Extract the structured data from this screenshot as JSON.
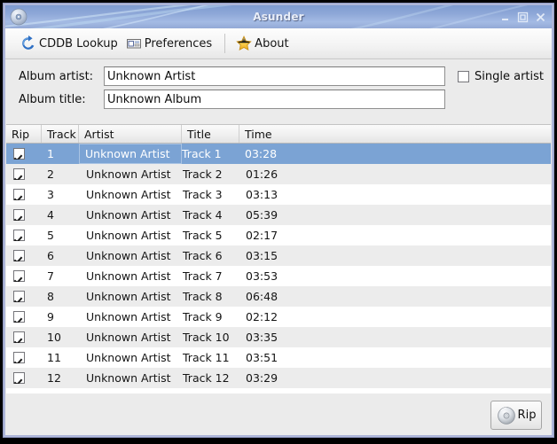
{
  "window": {
    "title": "Asunder",
    "icon": "cd-disc-icon",
    "controls": {
      "minimize": "–",
      "maximize": "❒",
      "close": "✕"
    },
    "border_color": "#b3bbdd",
    "titlebar_color": "#8fa8d8"
  },
  "toolbar": {
    "items": [
      {
        "label": "CDDB Lookup",
        "icon": "refresh-circle-icon"
      },
      {
        "label": "Preferences",
        "icon": "window-panel-icon"
      },
      {
        "label": "About",
        "icon": "star-icon"
      }
    ]
  },
  "form": {
    "album_artist": {
      "label": "Album artist:",
      "value": "Unknown Artist",
      "placeholder": ""
    },
    "album_title": {
      "label": "Album title:",
      "value": "Unknown Album",
      "placeholder": ""
    },
    "single_artist": {
      "label": "Single artist",
      "checked": false
    }
  },
  "track_list": {
    "columns": [
      "Rip",
      "Track",
      "Artist",
      "Title",
      "Time"
    ],
    "selected_index": 0,
    "selection_color": "#7ba3d4",
    "alt_row_color": "#ececec",
    "rows": [
      {
        "rip": true,
        "track": "1",
        "artist": "Unknown Artist",
        "title": "Track 1",
        "time": "03:28"
      },
      {
        "rip": true,
        "track": "2",
        "artist": "Unknown Artist",
        "title": "Track 2",
        "time": "01:26"
      },
      {
        "rip": true,
        "track": "3",
        "artist": "Unknown Artist",
        "title": "Track 3",
        "time": "03:13"
      },
      {
        "rip": true,
        "track": "4",
        "artist": "Unknown Artist",
        "title": "Track 4",
        "time": "05:39"
      },
      {
        "rip": true,
        "track": "5",
        "artist": "Unknown Artist",
        "title": "Track 5",
        "time": "02:17"
      },
      {
        "rip": true,
        "track": "6",
        "artist": "Unknown Artist",
        "title": "Track 6",
        "time": "03:15"
      },
      {
        "rip": true,
        "track": "7",
        "artist": "Unknown Artist",
        "title": "Track 7",
        "time": "03:53"
      },
      {
        "rip": true,
        "track": "8",
        "artist": "Unknown Artist",
        "title": "Track 8",
        "time": "06:48"
      },
      {
        "rip": true,
        "track": "9",
        "artist": "Unknown Artist",
        "title": "Track 9",
        "time": "02:12"
      },
      {
        "rip": true,
        "track": "10",
        "artist": "Unknown Artist",
        "title": "Track 10",
        "time": "03:35"
      },
      {
        "rip": true,
        "track": "11",
        "artist": "Unknown Artist",
        "title": "Track 11",
        "time": "03:51"
      },
      {
        "rip": true,
        "track": "12",
        "artist": "Unknown Artist",
        "title": "Track 12",
        "time": "03:29"
      }
    ]
  },
  "footer": {
    "rip_button": {
      "label": "Rip",
      "icon": "cd-disc-icon"
    }
  }
}
